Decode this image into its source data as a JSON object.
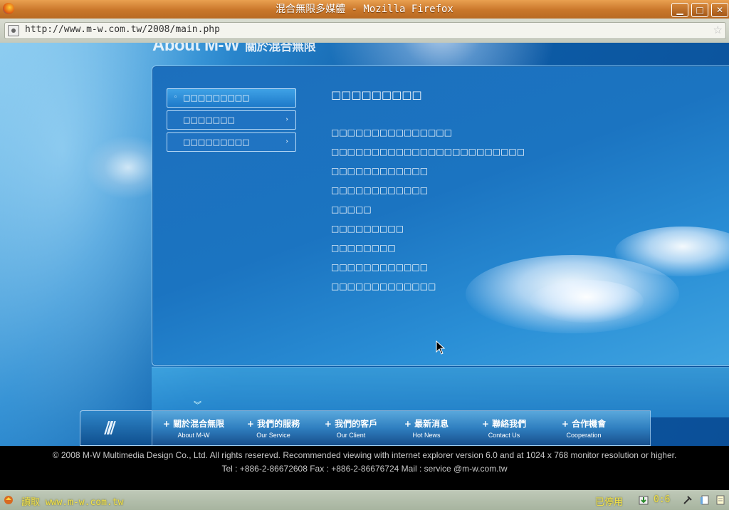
{
  "window": {
    "title": "混合無限多媒體 - Mozilla Firefox",
    "buttons": {
      "minimize": "▁",
      "maximize": "□",
      "close": "✕"
    }
  },
  "address_bar": {
    "url": "http://www.m-w.com.tw/2008/main.php"
  },
  "page": {
    "header_title_en": "About M-W",
    "header_title_zh": "關於混合無限",
    "submenu": [
      {
        "label": "□□□□□□□□□",
        "active": true
      },
      {
        "label": "□□□□□□□",
        "active": false
      },
      {
        "label": "□□□□□□□□□",
        "active": false
      }
    ],
    "article": {
      "heading": "□□□□□□□□□",
      "lines": [
        "□□□□□□□□□□□□□□□",
        "□□□□□□□□□□□□□□□□□□□□□□□□",
        "□□□□□□□□□□□□",
        "□□□□□□□□□□□□",
        "□□□□□",
        "□□□□□□□□□",
        "□□□□□□□□",
        "□□□□□□□□□□□□",
        "□□□□□□□□□□□□□"
      ]
    },
    "scroll_hint": "︾",
    "bottom_nav": [
      {
        "zh": "+ 關於混合無限",
        "en": "About  M-W"
      },
      {
        "zh": "+ 我們的服務",
        "en": "Our Service"
      },
      {
        "zh": "+ 我們的客戶",
        "en": "Our Client"
      },
      {
        "zh": "+ 最新消息",
        "en": "Hot News"
      },
      {
        "zh": "+ 聯絡我們",
        "en": "Contact Us"
      },
      {
        "zh": "+ 合作機會",
        "en": "Cooperation"
      }
    ],
    "footer": {
      "line1": "© 2008 M-W Multimedia Design Co., Ltd.  All rights reserevd.  Recommended viewing with internet explorer version 6.0 and at 1024 x 768 monitor resolution or  higher.",
      "line2": "Tel : +886-2-86672608  Fax : +886-2-86676724  Mail : service @m-w.com.tw"
    }
  },
  "status_bar": {
    "text": "讀取 www.m-w.com.tw",
    "disabled_label": "已停用",
    "counter": "0:6"
  }
}
